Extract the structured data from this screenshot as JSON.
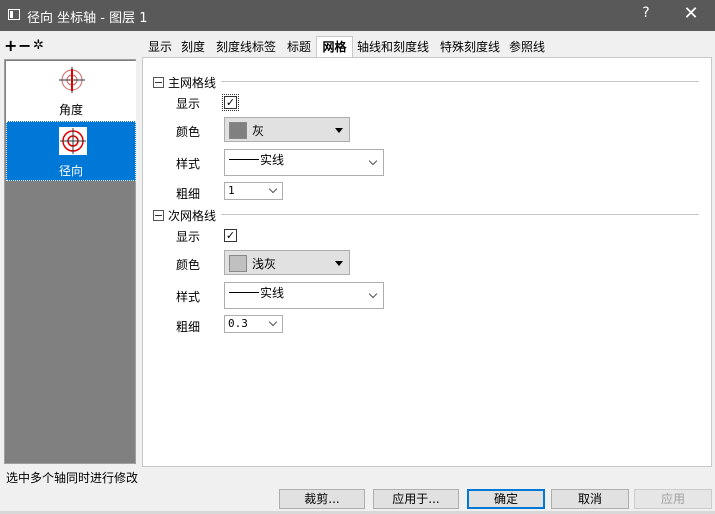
{
  "window": {
    "title": "径向 坐标轴 - 图层 1",
    "help": "?",
    "close": "✕"
  },
  "toolbar": {
    "add": "+",
    "remove": "−",
    "settings": "✲"
  },
  "sidebar": {
    "items": [
      {
        "label": "角度",
        "icon": "angle-axis-icon",
        "selected": false
      },
      {
        "label": "径向",
        "icon": "radial-axis-icon",
        "selected": true
      }
    ]
  },
  "tabs": [
    {
      "label": "显示"
    },
    {
      "label": "刻度"
    },
    {
      "label": "刻度线标签"
    },
    {
      "label": "标题"
    },
    {
      "label": "网格",
      "active": true
    },
    {
      "label": "轴线和刻度线"
    },
    {
      "label": "特殊刻度线"
    },
    {
      "label": "参照线"
    }
  ],
  "major": {
    "header": "主网格线",
    "show_label": "显示",
    "show_checked": true,
    "color_label": "颜色",
    "color_value": "灰",
    "color_hex": "#808080",
    "style_label": "样式",
    "style_value": "实线",
    "width_label": "粗细",
    "width_value": "1"
  },
  "minor": {
    "header": "次网格线",
    "show_label": "显示",
    "show_checked": true,
    "color_label": "颜色",
    "color_value": "浅灰",
    "color_hex": "#c0c0c0",
    "style_label": "样式",
    "style_value": "实线",
    "width_label": "粗细",
    "width_value": "0.3"
  },
  "status_text": "选中多个轴同时进行修改",
  "buttons": {
    "crop": "裁剪...",
    "apply_to": "应用于...",
    "ok": "确定",
    "cancel": "取消",
    "apply": "应用"
  },
  "colors": {
    "accent": "#0078d7",
    "titlebar": "#595959",
    "sidebar_bg": "#808080"
  }
}
